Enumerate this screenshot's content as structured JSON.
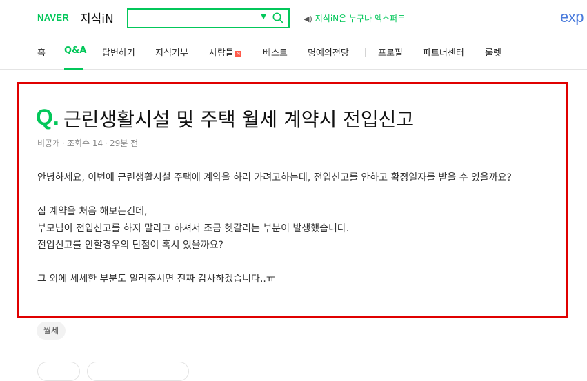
{
  "header": {
    "brand": "NAVER",
    "service": "지식iN",
    "search": {
      "value": "",
      "placeholder": ""
    },
    "expert_link": "지식iN은 누구나 엑스퍼트",
    "exp_logo": "exp"
  },
  "nav": {
    "items": [
      {
        "label": "홈"
      },
      {
        "label": "Q&A"
      },
      {
        "label": "답변하기"
      },
      {
        "label": "지식기부"
      },
      {
        "label": "사람들",
        "badge": "N"
      },
      {
        "label": "베스트"
      },
      {
        "label": "명예의전당"
      },
      {
        "label": "프로필"
      },
      {
        "label": "파트너센터"
      },
      {
        "label": "룰렛"
      }
    ],
    "active": "Q&A"
  },
  "question": {
    "q_mark": "Q.",
    "title": "근린생활시설 및 주택 월세 계약시 전입신고",
    "meta": {
      "author": "비공개",
      "views": "조회수 14",
      "time": "29분 전"
    },
    "body": {
      "p1": "안녕하세요, 이번에 근린생활시설 주택에 계약을 하러 가려고하는데, 전입신고를 안하고 확정일자를 받을 수 있을까요?",
      "p2a": "집 계약을 처음 해보는건데,",
      "p2b": "부모님이 전입신고를 하지 말라고 하셔서 조금 헷갈리는 부분이 발생했습니다.",
      "p2c": "전입신고를 안할경우의 단점이 혹시 있을까요?",
      "p3": "그 외에 세세한 부분도 알려주시면 진짜 감사하겠습니다..ㅠ"
    },
    "tag": "월세"
  },
  "colors": {
    "brand_green": "#03c75a",
    "highlight_border": "#e00000",
    "exp_blue": "#4a7bdc"
  }
}
